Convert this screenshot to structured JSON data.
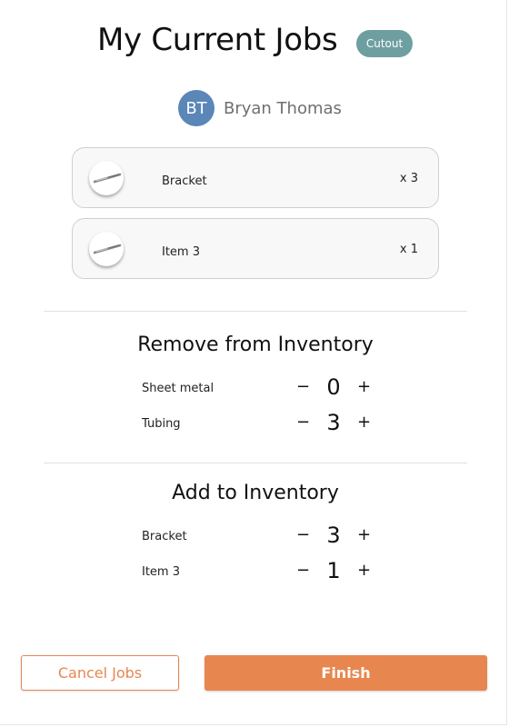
{
  "header": {
    "title": "My Current Jobs",
    "badge": "Cutout"
  },
  "user": {
    "initials": "BT",
    "name": "Bryan Thomas",
    "avatar_color": "#5a86b8"
  },
  "jobs": [
    {
      "name": "Bracket",
      "quantity": "x 3",
      "thumbnail_icon": "drill-bit-icon"
    },
    {
      "name": "Item 3",
      "quantity": "x 1",
      "thumbnail_icon": "drill-bit-icon"
    }
  ],
  "remove_section": {
    "title": "Remove from Inventory",
    "items": [
      {
        "label": "Sheet metal",
        "value": "0",
        "minus": "−",
        "plus": "+"
      },
      {
        "label": "Tubing",
        "value": "3",
        "minus": "−",
        "plus": "+"
      }
    ]
  },
  "add_section": {
    "title": "Add to Inventory",
    "items": [
      {
        "label": "Bracket",
        "value": "3",
        "minus": "−",
        "plus": "+"
      },
      {
        "label": "Item 3",
        "value": "1",
        "minus": "−",
        "plus": "+"
      }
    ]
  },
  "actions": {
    "cancel_label": "Cancel Jobs",
    "finish_label": "Finish"
  },
  "colors": {
    "accent": "#e8864f",
    "badge": "#6e9fa0"
  }
}
